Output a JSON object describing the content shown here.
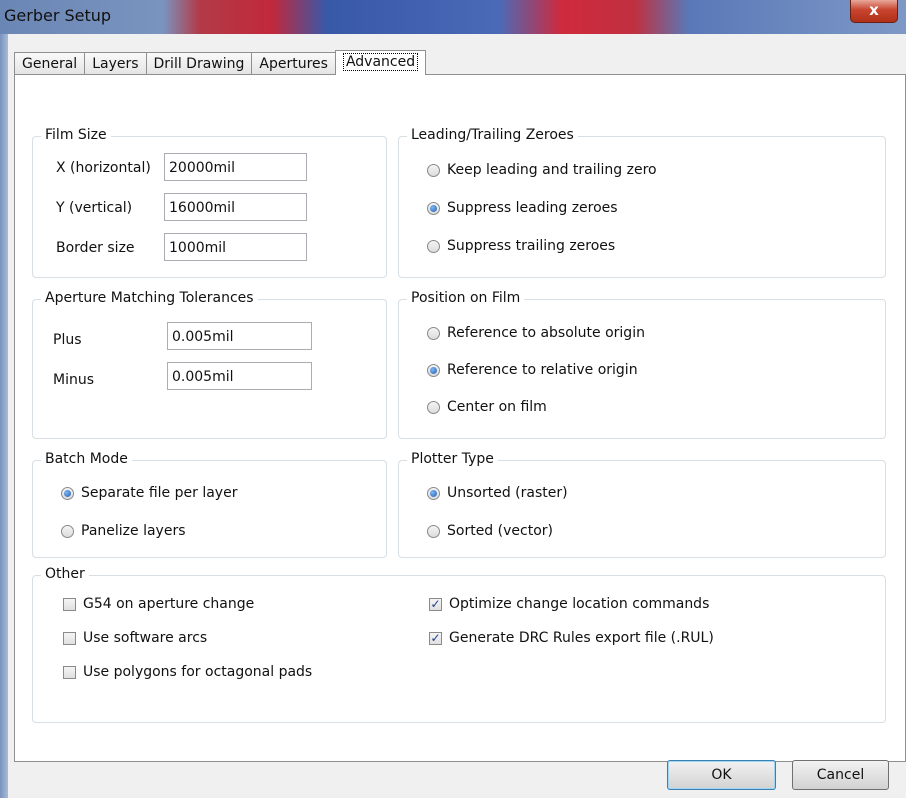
{
  "window": {
    "title": "Gerber Setup",
    "close_glyph": "x"
  },
  "tabs": [
    "General",
    "Layers",
    "Drill Drawing",
    "Apertures",
    "Advanced"
  ],
  "film_size": {
    "legend": "Film Size",
    "x_label": "X (horizontal)",
    "x_value": "20000mil",
    "y_label": "Y (vertical)",
    "y_value": "16000mil",
    "border_label": "Border size",
    "border_value": "1000mil"
  },
  "aperture": {
    "legend": "Aperture Matching Tolerances",
    "plus_label": "Plus",
    "plus_value": "0.005mil",
    "minus_label": "Minus",
    "minus_value": "0.005mil"
  },
  "zeroes": {
    "legend": "Leading/Trailing Zeroes",
    "options": [
      "Keep leading and trailing zero",
      "Suppress leading zeroes",
      "Suppress trailing zeroes"
    ],
    "selected": 1
  },
  "position": {
    "legend": "Position on Film",
    "options": [
      "Reference to absolute origin",
      "Reference to relative origin",
      "Center on film"
    ],
    "selected": 1
  },
  "batch": {
    "legend": "Batch Mode",
    "options": [
      "Separate file per layer",
      "Panelize layers"
    ],
    "selected": 0
  },
  "plotter": {
    "legend": "Plotter Type",
    "options": [
      "Unsorted (raster)",
      "Sorted (vector)"
    ],
    "selected": 0
  },
  "other": {
    "legend": "Other",
    "checks": [
      {
        "label": "G54 on aperture change",
        "checked": false
      },
      {
        "label": "Use software arcs",
        "checked": false
      },
      {
        "label": "Use polygons for octagonal pads",
        "checked": false
      },
      {
        "label": "Optimize change location commands",
        "checked": true
      },
      {
        "label": "Generate DRC Rules export file (.RUL)",
        "checked": true
      }
    ]
  },
  "buttons": {
    "ok": "OK",
    "cancel": "Cancel"
  }
}
